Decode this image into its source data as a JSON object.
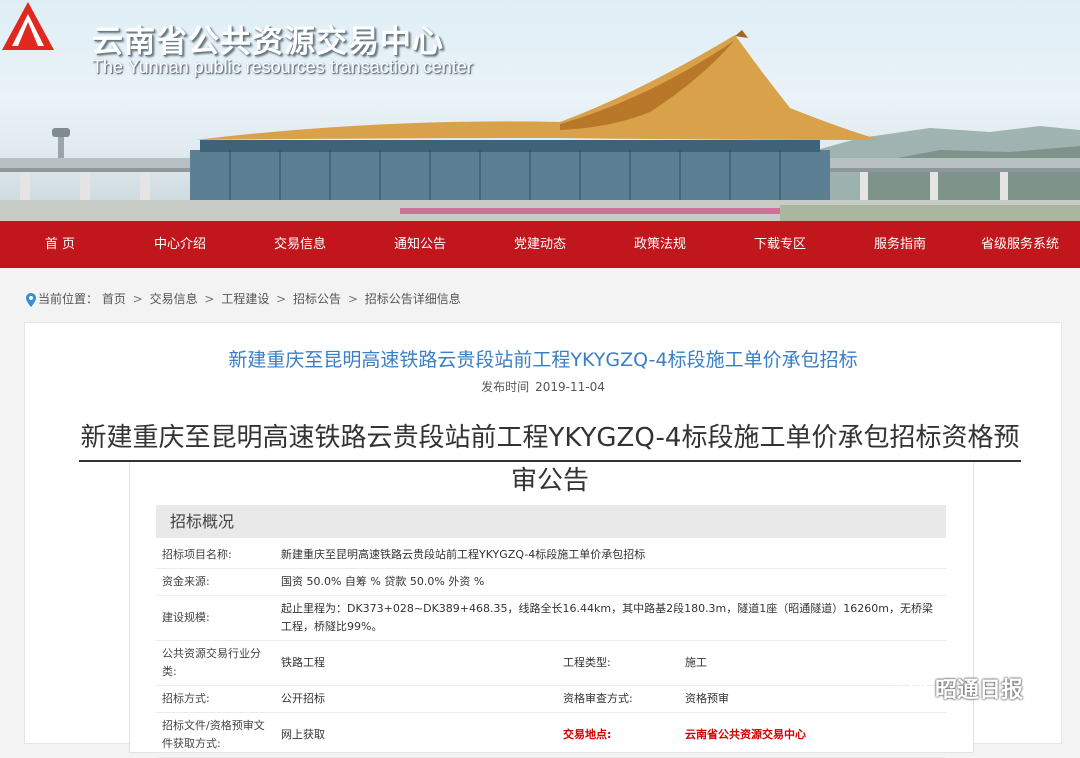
{
  "header": {
    "title": "云南省公共资源交易中心",
    "subtitle": "The Yunnan public resources transaction center"
  },
  "nav": [
    {
      "label": "首 页"
    },
    {
      "label": "中心介绍"
    },
    {
      "label": "交易信息"
    },
    {
      "label": "通知公告"
    },
    {
      "label": "党建动态"
    },
    {
      "label": "政策法规"
    },
    {
      "label": "下载专区"
    },
    {
      "label": "服务指南"
    },
    {
      "label": "省级服务系统"
    }
  ],
  "breadcrumb": {
    "prefix": "当前位置：",
    "items": [
      "首页",
      "交易信息",
      "工程建设",
      "招标公告",
      "招标公告详细信息"
    ],
    "separator": ">"
  },
  "notice": {
    "heading": "新建重庆至昆明高速铁路云贵段站前工程YKYGZQ-4标段施工单价承包招标",
    "publish_label": "发布时间",
    "publish_date": "2019-11-04",
    "doc_title_line1": "新建重庆至昆明高速铁路云贵段站前工程YKYGZQ-4标段施工单价承包招标资格预",
    "doc_title_line2": "审公告"
  },
  "overview": {
    "section_title": "招标概况",
    "rows": {
      "project_name_label": "招标项目名称:",
      "project_name": "新建重庆至昆明高速铁路云贵段站前工程YKYGZQ-4标段施工单价承包招标",
      "funding_label": "资金来源:",
      "funding": "国资 50.0% 自筹 % 贷款 50.0% 外资 %",
      "scale_label": "建设规模:",
      "scale": "起止里程为：DK373+028~DK389+468.35，线路全长16.44km，其中路基2段180.3m，隧道1座（昭通隧道）16260m，无桥梁工程，桥隧比99%。",
      "industry_label": "公共资源交易行业分类:",
      "industry": "铁路工程",
      "project_type_label": "工程类型:",
      "project_type": "施工",
      "method_label": "招标方式:",
      "method": "公开招标",
      "review_label": "资格审查方式:",
      "review": "资格预审",
      "doc_access_label": "招标文件/资格预审文件获取方式:",
      "doc_access": "网上获取",
      "venue_label": "交易地点:",
      "venue": "云南省公共资源交易中心"
    }
  },
  "watermark": {
    "text": "昭通日报"
  },
  "colors": {
    "nav_red": "#c1161c",
    "link_blue": "#3a7fc5",
    "highlight_red": "#d40000"
  }
}
